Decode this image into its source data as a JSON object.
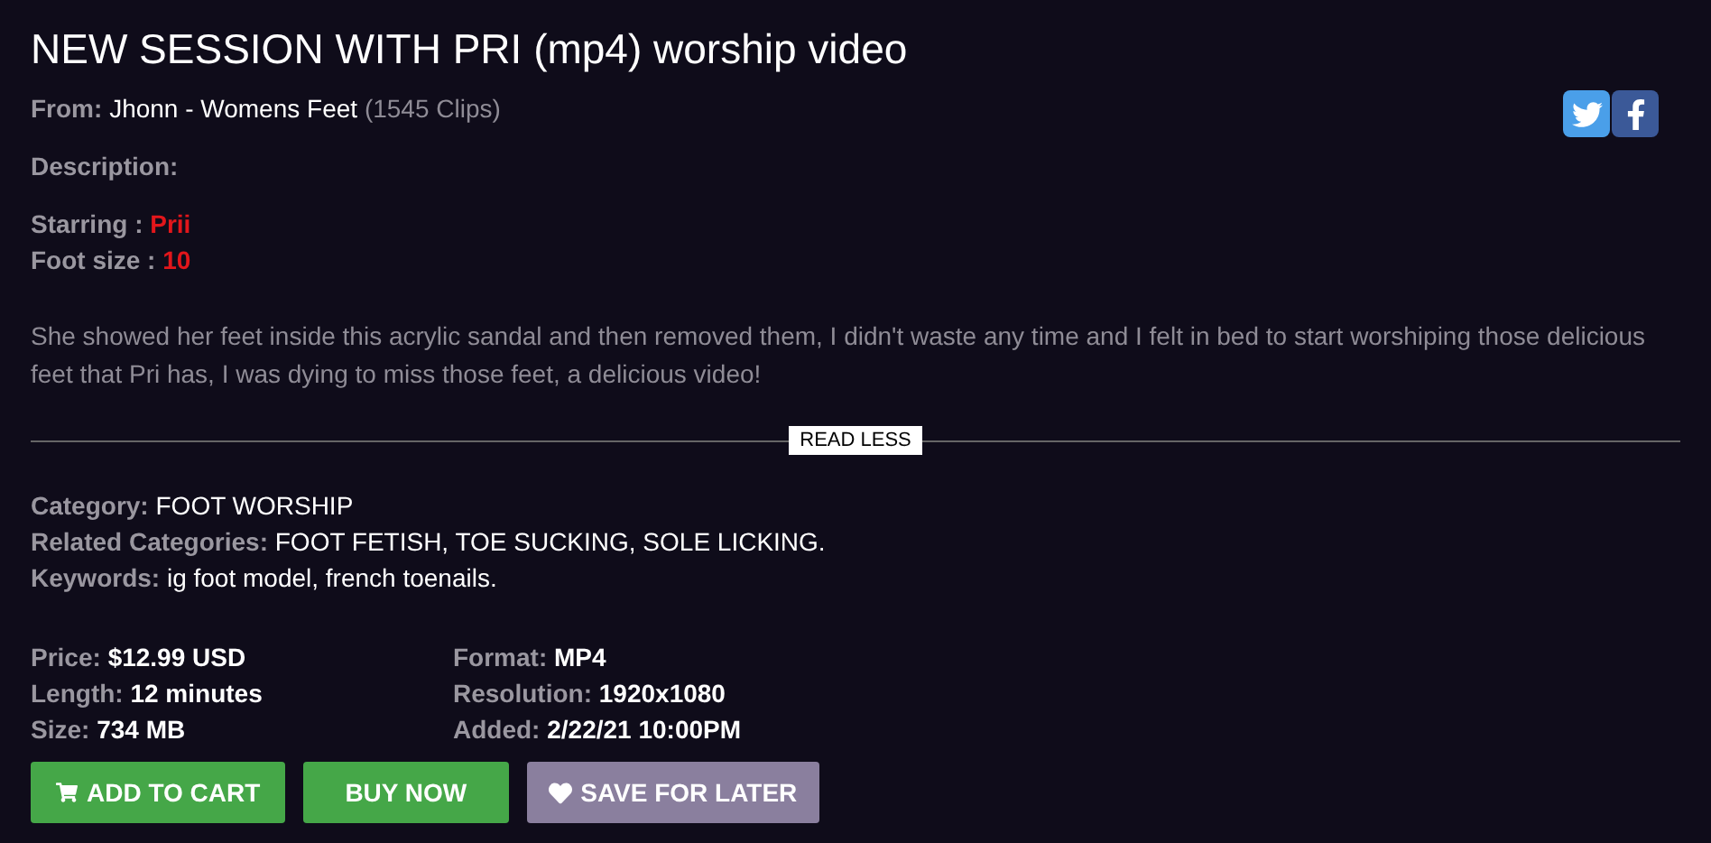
{
  "title": "NEW SESSION WITH PRI (mp4) worship video",
  "from": {
    "label": "From:",
    "studio": "Jhonn - Womens Feet",
    "count": "(1545 Clips)"
  },
  "share": [
    {
      "kind": "twitter"
    },
    {
      "kind": "facebook"
    }
  ],
  "description_label": "Description:",
  "facts": [
    {
      "label": "Starring :",
      "value": "Prii"
    },
    {
      "label": "Foot size :",
      "value": "10"
    }
  ],
  "description": "She showed her feet inside this acrylic sandal and then removed them, I didn't waste any time and I felt in bed to start worshiping those delicious feet that Pri has, I was dying to miss those feet, a delicious video!",
  "read_less": "READ LESS",
  "categories": [
    {
      "label": "Category:",
      "value": "FOOT WORSHIP"
    },
    {
      "label": "Related Categories:",
      "value": "FOOT FETISH, TOE SUCKING, SOLE LICKING."
    },
    {
      "label": "Keywords:",
      "value": "ig foot model, french toenails."
    }
  ],
  "details": [
    {
      "label": "Price:",
      "value": "$12.99 USD"
    },
    {
      "label": "Format:",
      "value": "MP4"
    },
    {
      "label": "Length:",
      "value": "12 minutes"
    },
    {
      "label": "Resolution:",
      "value": "1920x1080"
    },
    {
      "label": "Size:",
      "value": "734 MB"
    },
    {
      "label": "Added:",
      "value": "2/22/21 10:00PM"
    }
  ],
  "buttons": [
    {
      "kind": "cart",
      "label": "ADD TO CART"
    },
    {
      "kind": "buy",
      "label": "BUY NOW"
    },
    {
      "kind": "save",
      "label": "SAVE FOR LATER"
    }
  ]
}
